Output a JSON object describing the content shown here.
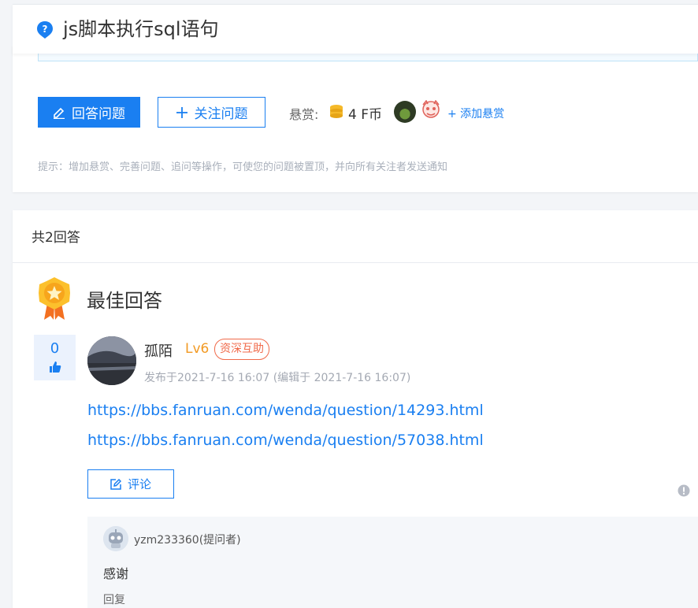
{
  "question": {
    "title": "js脚本执行sql语句",
    "answer_button": "回答问题",
    "follow_button": "关注问题",
    "reward_label": "悬赏:",
    "reward_value": "4 F币",
    "add_reward": "+ 添加悬赏",
    "hint": "提示：增加悬赏、完善问题、追问等操作，可使您的问题被置顶，并向所有关注者发送通知"
  },
  "answers": {
    "count_label": "共2回答",
    "best_label": "最佳回答",
    "best": {
      "votes": "0",
      "user_name": "孤陌",
      "level": "Lv6",
      "badge": "资深互助",
      "meta": "发布于2021-7-16 16:07  (编辑于 2021-7-16 16:07)",
      "links": [
        "https://bbs.fanruan.com/wenda/question/14293.html",
        "https://bbs.fanruan.com/wenda/question/57038.html"
      ],
      "comment_button": "评论",
      "comment": {
        "user": "yzm233360(提问者)",
        "text": "感谢",
        "reply": "回复"
      }
    }
  },
  "colors": {
    "accent": "#1a7ff1",
    "level": "#f29a24",
    "badge": "#f06a4a"
  },
  "icons": [
    "question-icon",
    "edit-icon",
    "plus-icon",
    "coin-icon",
    "medal-icon",
    "thumb-up-icon",
    "comment-edit-icon",
    "info-icon",
    "robot-avatar-icon"
  ]
}
